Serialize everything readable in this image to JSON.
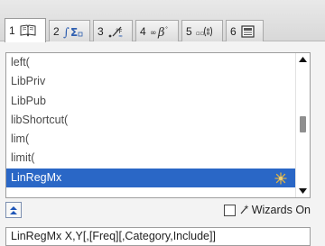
{
  "tabs": [
    {
      "number": "1",
      "icon": "catalog-book-icon"
    },
    {
      "number": "2",
      "icon": "math-templates-icon"
    },
    {
      "number": "3",
      "icon": "symbols-icon"
    },
    {
      "number": "4",
      "icon": "greek-letters-icon"
    },
    {
      "number": "5",
      "icon": "units-icon"
    },
    {
      "number": "6",
      "icon": "library-icon"
    }
  ],
  "catalog": {
    "items": [
      "left(",
      "LibPriv",
      "LibPub",
      "libShortcut(",
      "lim(",
      "limit(",
      "LinRegMx"
    ],
    "selected": "LinRegMx"
  },
  "wizards": {
    "label": "Wizards On",
    "checked": false
  },
  "syntax_help": "LinRegMx X,Y[,[Freq][,Category,Include]]",
  "colors": {
    "selection": "#2a67c6",
    "tab_bar": "#dcdcdc",
    "panel": "#f3f3f3"
  }
}
